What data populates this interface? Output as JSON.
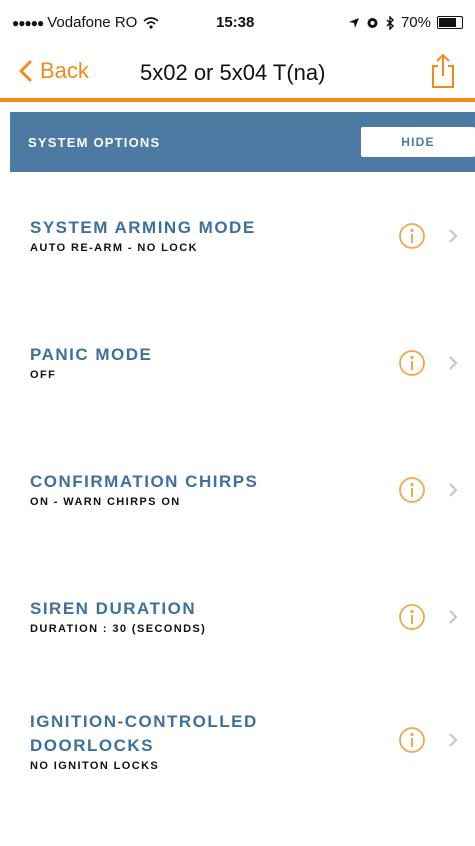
{
  "status_bar": {
    "carrier": "Vodafone RO",
    "time": "15:38",
    "battery": "70%"
  },
  "nav": {
    "back_label": "Back",
    "title": "5x02 or 5x04 T(na)"
  },
  "section": {
    "title": "System Options",
    "hide_label": "Hide"
  },
  "options": [
    {
      "title": "System Arming Mode",
      "value": "Auto re-arm - no lock"
    },
    {
      "title": "Panic Mode",
      "value": "Off"
    },
    {
      "title": "Confirmation Chirps",
      "value": "On - warn chirps on"
    },
    {
      "title": "Siren Duration",
      "value": "Duration : 30 (seconds)"
    },
    {
      "title": "Ignition-Controlled DoorLocks",
      "value": "No igniton locks"
    }
  ],
  "colors": {
    "accent": "#f08a1c",
    "section_bg": "#4d7aa2",
    "title_blue": "#3d70a0"
  }
}
